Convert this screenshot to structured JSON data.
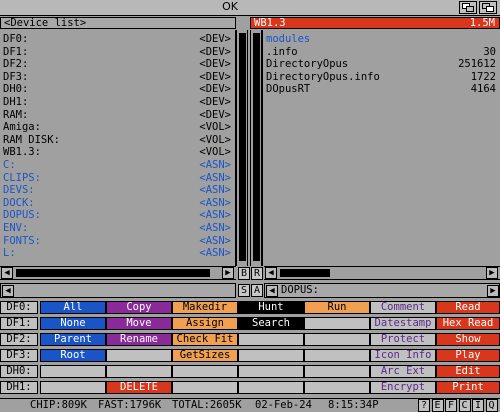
{
  "window": {
    "title": "OK"
  },
  "left_panel": {
    "header": "<Device list>",
    "rows": [
      {
        "name": "DF0:",
        "type": "<DEV>",
        "kind": "dev"
      },
      {
        "name": "DF1:",
        "type": "<DEV>",
        "kind": "dev"
      },
      {
        "name": "DF2:",
        "type": "<DEV>",
        "kind": "dev"
      },
      {
        "name": "DF3:",
        "type": "<DEV>",
        "kind": "dev"
      },
      {
        "name": "DH0:",
        "type": "<DEV>",
        "kind": "dev"
      },
      {
        "name": "DH1:",
        "type": "<DEV>",
        "kind": "dev"
      },
      {
        "name": "RAM:",
        "type": "<DEV>",
        "kind": "dev"
      },
      {
        "name": "Amiga:",
        "type": "<VOL>",
        "kind": "vol"
      },
      {
        "name": "RAM DISK:",
        "type": "<VOL>",
        "kind": "vol"
      },
      {
        "name": "WB1.3:",
        "type": "<VOL>",
        "kind": "vol"
      },
      {
        "name": "C:",
        "type": "<ASN>",
        "kind": "asn"
      },
      {
        "name": "CLIPS:",
        "type": "<ASN>",
        "kind": "asn"
      },
      {
        "name": "DEVS:",
        "type": "<ASN>",
        "kind": "asn"
      },
      {
        "name": "DOCK:",
        "type": "<ASN>",
        "kind": "asn"
      },
      {
        "name": "DOPUS:",
        "type": "<ASN>",
        "kind": "asn"
      },
      {
        "name": "ENV:",
        "type": "<ASN>",
        "kind": "asn"
      },
      {
        "name": "FONTS:",
        "type": "<ASN>",
        "kind": "asn"
      },
      {
        "name": "L:",
        "type": "<ASN>",
        "kind": "asn"
      }
    ]
  },
  "right_panel": {
    "header_left": "WB1.3",
    "header_right": "1.5M",
    "rows": [
      {
        "name": "modules",
        "size": "",
        "kind": "dir"
      },
      {
        "name": ".info",
        "size": "30",
        "kind": "file"
      },
      {
        "name": "DirectoryOpus",
        "size": "251612",
        "kind": "file"
      },
      {
        "name": "DirectoryOpus.info",
        "size": "1722",
        "kind": "file"
      },
      {
        "name": "DOpusRT",
        "size": "4164",
        "kind": "file"
      }
    ],
    "path": "DOPUS:"
  },
  "scroll_letters": {
    "b": "B",
    "r": "R",
    "s": "S",
    "a": "A"
  },
  "drives": [
    "DF0:",
    "DF1:",
    "DF2:",
    "DF3:",
    "DH0:",
    "DH1:"
  ],
  "buttons_left": [
    [
      {
        "label": "All",
        "color": "#1a55c8",
        "fg": "#ffffff"
      },
      {
        "label": "Copy",
        "color": "#8a2a9a",
        "fg": "#ffffff"
      },
      {
        "label": "Makedir",
        "color": "#f0a050",
        "fg": "#000000"
      },
      {
        "label": "Hunt",
        "color": "#000000",
        "fg": "#ffffff"
      },
      {
        "label": "Run",
        "color": "#f0a050",
        "fg": "#000000"
      }
    ],
    [
      {
        "label": "None",
        "color": "#1a55c8",
        "fg": "#ffffff"
      },
      {
        "label": "Move",
        "color": "#8a2a9a",
        "fg": "#ffffff"
      },
      {
        "label": "Assign",
        "color": "#f0a050",
        "fg": "#000000"
      },
      {
        "label": "Search",
        "color": "#000000",
        "fg": "#ffffff"
      },
      {
        "label": "",
        "color": "#c0c0c0",
        "fg": "#000000"
      }
    ],
    [
      {
        "label": "Parent",
        "color": "#1a55c8",
        "fg": "#ffffff"
      },
      {
        "label": "Rename",
        "color": "#8a2a9a",
        "fg": "#ffffff"
      },
      {
        "label": "Check Fit",
        "color": "#f0a050",
        "fg": "#000000"
      },
      {
        "label": "",
        "color": "#c0c0c0",
        "fg": "#000000"
      },
      {
        "label": "",
        "color": "#c0c0c0",
        "fg": "#000000"
      }
    ],
    [
      {
        "label": "Root",
        "color": "#1a55c8",
        "fg": "#ffffff"
      },
      {
        "label": "",
        "color": "#c0c0c0",
        "fg": "#000000"
      },
      {
        "label": "GetSizes",
        "color": "#f0a050",
        "fg": "#000000"
      },
      {
        "label": "",
        "color": "#c0c0c0",
        "fg": "#000000"
      },
      {
        "label": "",
        "color": "#c0c0c0",
        "fg": "#000000"
      }
    ],
    [
      {
        "label": "",
        "color": "#c0c0c0",
        "fg": "#000000"
      },
      {
        "label": "",
        "color": "#c0c0c0",
        "fg": "#000000"
      },
      {
        "label": "",
        "color": "#c0c0c0",
        "fg": "#000000"
      },
      {
        "label": "",
        "color": "#c0c0c0",
        "fg": "#000000"
      },
      {
        "label": "",
        "color": "#c0c0c0",
        "fg": "#000000"
      }
    ],
    [
      {
        "label": "",
        "color": "#c0c0c0",
        "fg": "#000000"
      },
      {
        "label": "DELETE",
        "color": "#d8371c",
        "fg": "#ffffff"
      },
      {
        "label": "",
        "color": "#c0c0c0",
        "fg": "#000000"
      },
      {
        "label": "",
        "color": "#c0c0c0",
        "fg": "#000000"
      },
      {
        "label": "",
        "color": "#c0c0c0",
        "fg": "#000000"
      }
    ]
  ],
  "buttons_right": [
    [
      {
        "label": "Comment",
        "color": "#c0c0c0",
        "fg": "#5a2a8a"
      },
      {
        "label": "Read",
        "color": "#d8371c",
        "fg": "#ffffff"
      }
    ],
    [
      {
        "label": "Datestamp",
        "color": "#c0c0c0",
        "fg": "#5a2a8a"
      },
      {
        "label": "Hex Read",
        "color": "#d8371c",
        "fg": "#ffffff"
      }
    ],
    [
      {
        "label": "Protect",
        "color": "#c0c0c0",
        "fg": "#5a2a8a"
      },
      {
        "label": "Show",
        "color": "#d8371c",
        "fg": "#ffffff"
      }
    ],
    [
      {
        "label": "Icon Info",
        "color": "#c0c0c0",
        "fg": "#5a2a8a"
      },
      {
        "label": "Play",
        "color": "#d8371c",
        "fg": "#ffffff"
      }
    ],
    [
      {
        "label": "Arc Ext",
        "color": "#c0c0c0",
        "fg": "#5a2a8a"
      },
      {
        "label": "Edit",
        "color": "#d8371c",
        "fg": "#ffffff"
      }
    ],
    [
      {
        "label": "Encrypt",
        "color": "#c0c0c0",
        "fg": "#5a2a8a"
      },
      {
        "label": "Print",
        "color": "#d8371c",
        "fg": "#ffffff"
      }
    ]
  ],
  "status": {
    "chip": "CHIP:809K",
    "fast": "FAST:1796K",
    "total": "TOTAL:2605K",
    "date": "02-Feb-24",
    "time": "8:15:34P",
    "gadgets": [
      "?",
      "E",
      "F",
      "C",
      "I",
      "Q"
    ]
  },
  "colors": {
    "dev": "#000000",
    "vol": "#000000",
    "asn": "#1a55c8",
    "dir": "#1a55c8",
    "file": "#000000"
  }
}
